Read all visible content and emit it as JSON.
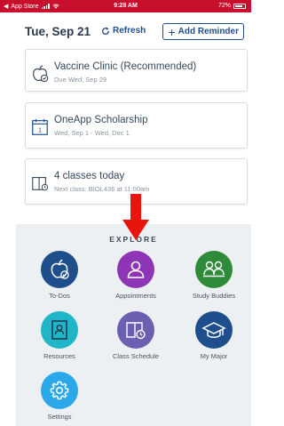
{
  "status_bar": {
    "back_app": "App Store",
    "time": "9:28 AM",
    "battery": "72%"
  },
  "header": {
    "date": "Tue, Sep 21",
    "refresh_label": "Refresh",
    "add_reminder_label": "Add Reminder"
  },
  "cards": [
    {
      "title": "Vaccine Clinic (Recommended)",
      "subtitle": "Due Wed, Sep 29",
      "icon": "apple-check-icon"
    },
    {
      "title": "OneApp Scholarship",
      "subtitle": "Wed, Sep 1 - Wed, Dec 1",
      "icon": "calendar-icon"
    },
    {
      "title": "4 classes today",
      "subtitle": "Next class: BIOL436 at 11:00am",
      "icon": "books-icon"
    }
  ],
  "explore": {
    "title": "EXPLORE",
    "tiles": [
      {
        "label": "To-Dos",
        "color": "#1f4e8c",
        "icon": "apple-check-icon"
      },
      {
        "label": "Appointments",
        "color": "#8e35b5",
        "icon": "person-icon"
      },
      {
        "label": "Study Buddies",
        "color": "#2e8b3a",
        "icon": "people-icon"
      },
      {
        "label": "Resources",
        "color": "#20b5c7",
        "icon": "document-icon"
      },
      {
        "label": "Class Schedule",
        "color": "#6a5fb0",
        "icon": "schedule-icon"
      },
      {
        "label": "My Major",
        "color": "#1f4e8c",
        "icon": "graduation-cap-icon"
      },
      {
        "label": "Settings",
        "color": "#2aa8ea",
        "icon": "gear-icon"
      }
    ]
  },
  "colors": {
    "status_bar": "#c8102e",
    "brand_blue": "#1f4e8c",
    "annotation_arrow": "#e8150d"
  }
}
